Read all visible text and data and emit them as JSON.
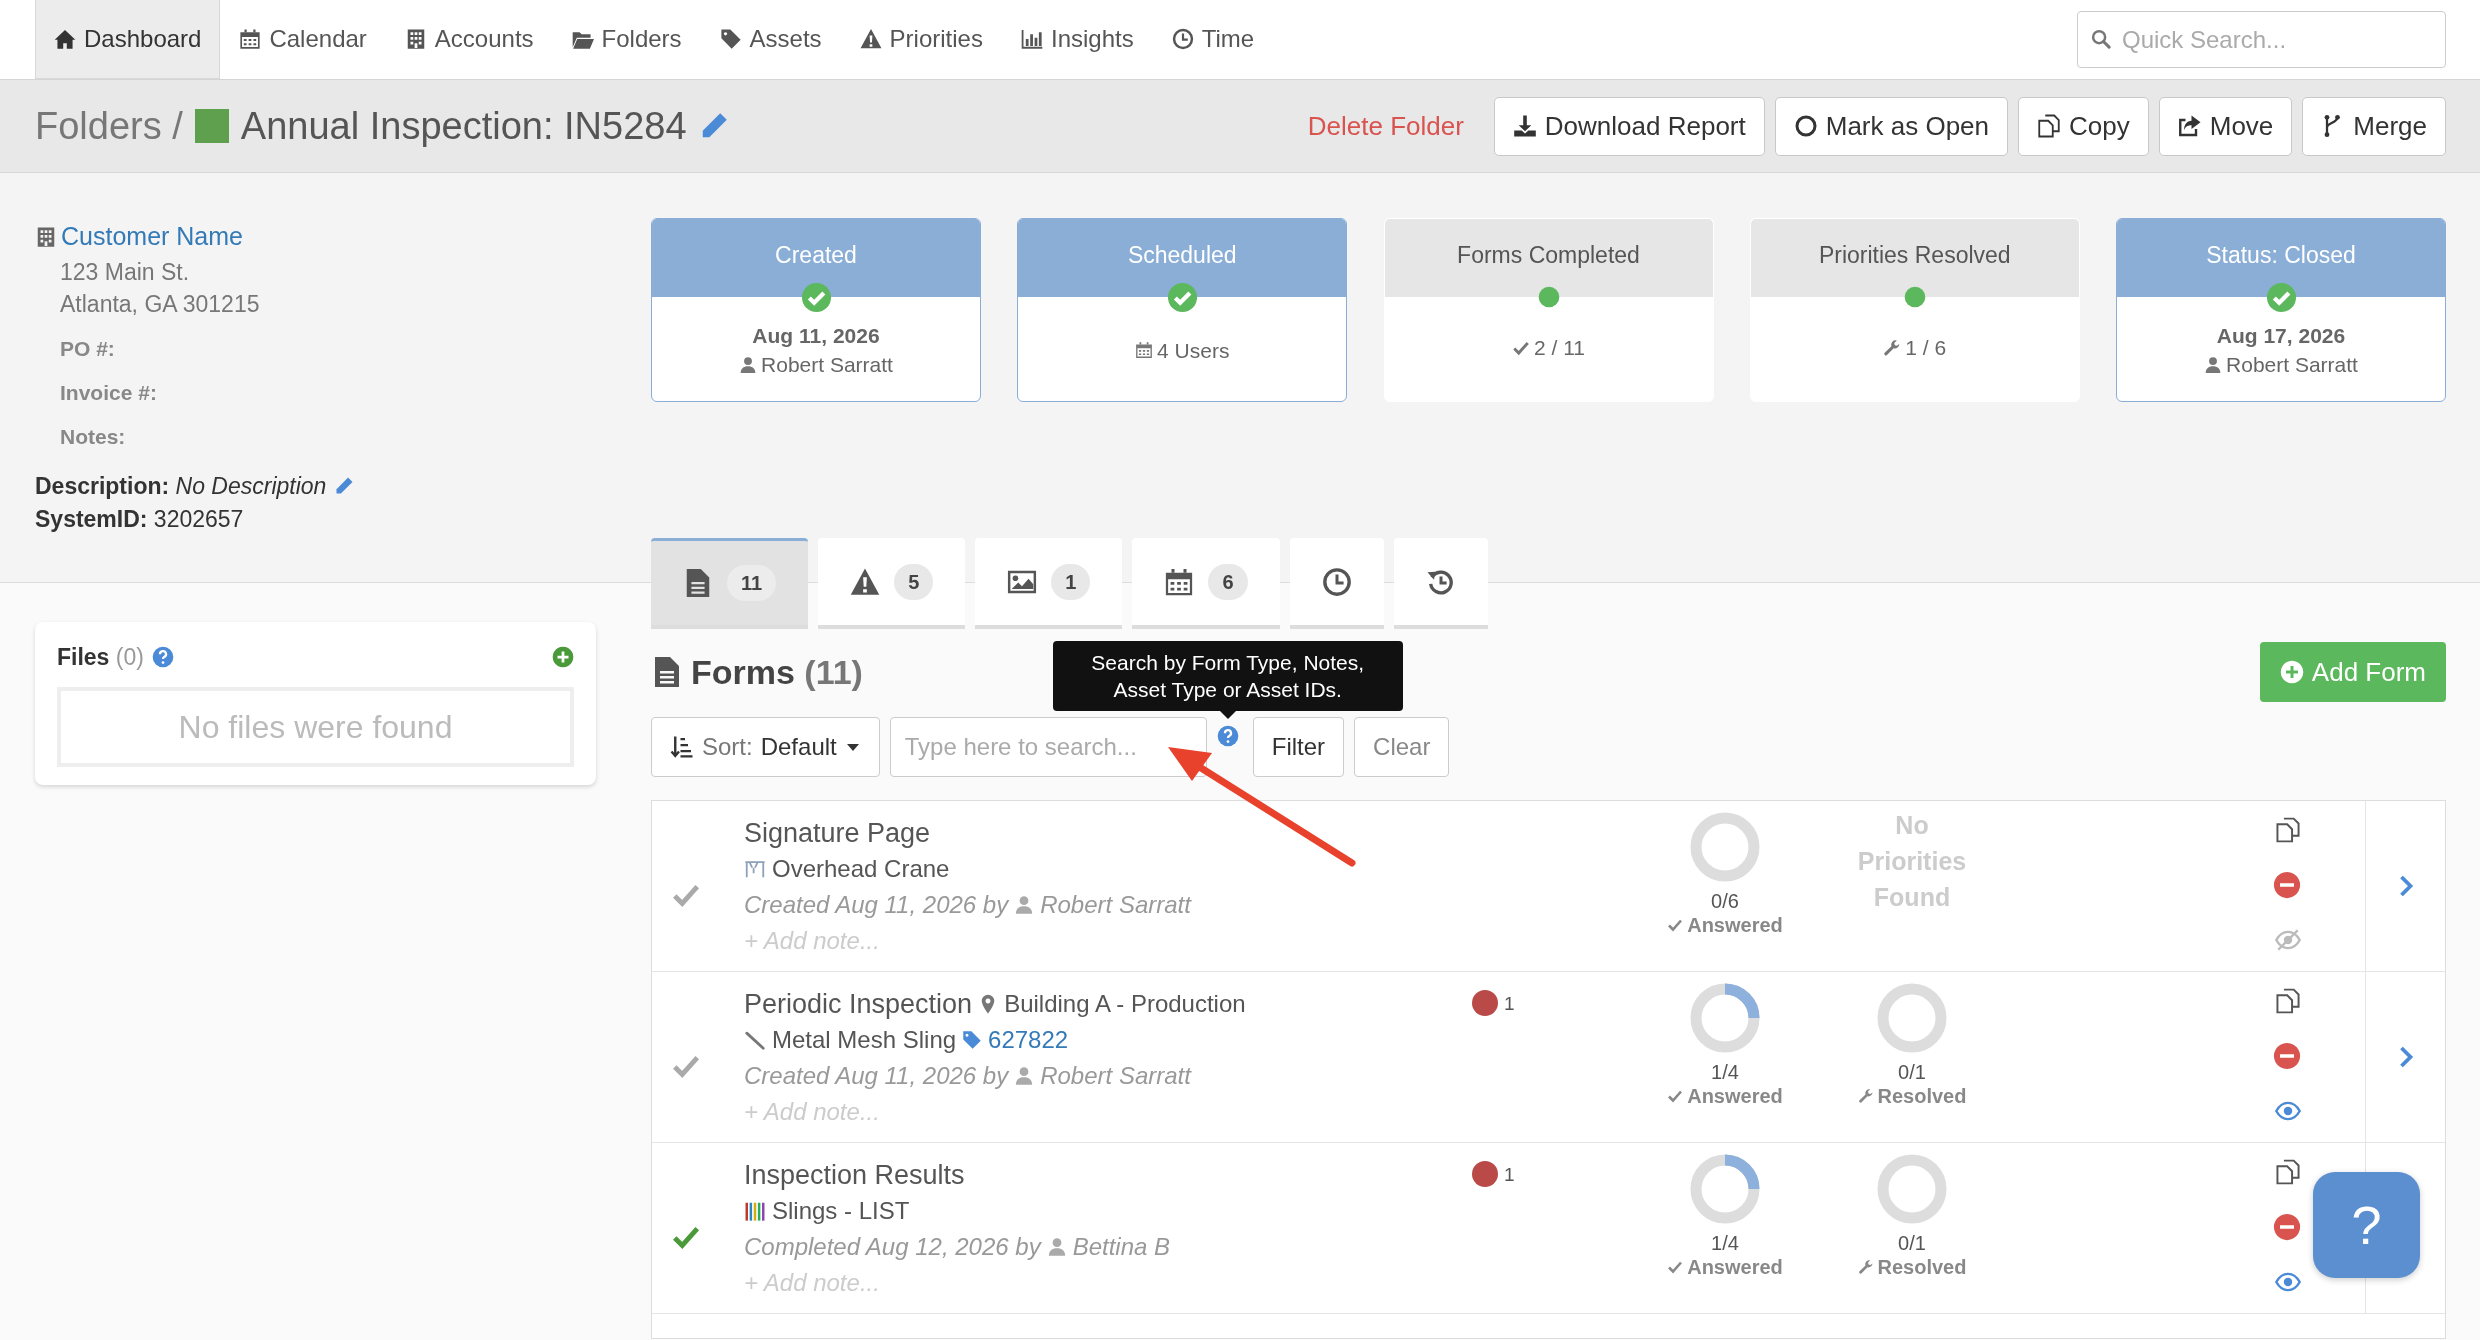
{
  "nav": {
    "items": [
      {
        "label": "Dashboard",
        "kind": "home",
        "selected": true
      },
      {
        "label": "Calendar",
        "kind": "calendar",
        "selected": false
      },
      {
        "label": "Accounts",
        "kind": "building",
        "selected": false
      },
      {
        "label": "Folders",
        "kind": "folder",
        "selected": false
      },
      {
        "label": "Assets",
        "kind": "tags",
        "selected": false
      },
      {
        "label": "Priorities",
        "kind": "warning",
        "selected": false
      },
      {
        "label": "Insights",
        "kind": "bars",
        "selected": false
      },
      {
        "label": "Time",
        "kind": "clock",
        "selected": false
      }
    ],
    "search": {
      "placeholder": "Quick Search..."
    }
  },
  "header": {
    "breadcrumb": "Folders /",
    "title": "Annual Inspection: IN5284",
    "actions": [
      {
        "label": "Delete Folder",
        "kind": "delete"
      },
      {
        "label": "Download Report",
        "kind": "download"
      },
      {
        "label": "Mark as Open",
        "kind": "open"
      },
      {
        "label": "Copy",
        "kind": "copy"
      },
      {
        "label": "Move",
        "kind": "move"
      },
      {
        "label": "Merge",
        "kind": "merge"
      }
    ]
  },
  "customer": {
    "name": "Customer Name",
    "address": [
      "123 Main St.",
      "Atlanta, GA 301215"
    ],
    "fields": [
      "PO #:",
      "Invoice #:",
      "Notes:"
    ],
    "description_label": "Description:",
    "description": "No Description",
    "system_label": "SystemID:",
    "system_id": "3202657"
  },
  "status_cards": [
    {
      "title": "Created",
      "done": true,
      "lines": [
        {
          "kind": "date",
          "text": "Aug 11, 2026"
        },
        {
          "kind": "user",
          "text": "Robert Sarratt"
        }
      ]
    },
    {
      "title": "Scheduled",
      "done": true,
      "lines": [
        {
          "kind": "users",
          "text": "4 Users"
        }
      ]
    },
    {
      "title": "Forms Completed",
      "done": false,
      "lines": [
        {
          "kind": "forms",
          "text": "2 / 11"
        }
      ]
    },
    {
      "title": "Priorities Resolved",
      "done": false,
      "lines": [
        {
          "kind": "priorities",
          "text": "1 / 6"
        }
      ]
    },
    {
      "title": "Status: Closed",
      "done": true,
      "lines": [
        {
          "kind": "date",
          "text": "Aug 17, 2026"
        },
        {
          "kind": "user",
          "text": "Robert Sarratt"
        }
      ]
    }
  ],
  "tabs": [
    {
      "kind": "forms",
      "count": "11",
      "selected": true
    },
    {
      "kind": "priorities",
      "count": "5",
      "selected": false
    },
    {
      "kind": "photos",
      "count": "1",
      "selected": false
    },
    {
      "kind": "schedule",
      "count": "6",
      "selected": false
    },
    {
      "kind": "time",
      "selected": false
    },
    {
      "kind": "history",
      "selected": false
    }
  ],
  "files": {
    "title": "Files",
    "count": "(0)",
    "empty": "No files were found"
  },
  "forms": {
    "title": "Forms",
    "count": "(11)",
    "add_button": "Add Form",
    "sort": {
      "label": "Sort:",
      "value": "Default"
    },
    "search": {
      "placeholder": "Type here to search..."
    },
    "tooltip": "Search by Form Type, Notes, Asset Type or Asset IDs.",
    "filter_button": "Filter",
    "clear_button": "Clear",
    "rows": [
      {
        "completed": false,
        "title": "Signature Page",
        "asset": {
          "kind": "crane",
          "name": "Overhead Crane"
        },
        "meta": "Created Aug 11, 2026 by",
        "user": "Robert Sarratt",
        "note": "+ Add note...",
        "answered": {
          "value": "0/6",
          "label": "Answered",
          "level": 0
        },
        "no_priorities": "No Priorities Found",
        "visible": false,
        "has_link": true
      },
      {
        "completed": false,
        "title": "Periodic Inspection",
        "location": "Building A - Production",
        "asset": {
          "kind": "sling",
          "name": "Metal Mesh Sling"
        },
        "tag": "627822",
        "meta": "Created Aug 11, 2026 by",
        "user": "Robert Sarratt",
        "note": "+ Add note...",
        "priority_count": "1",
        "answered": {
          "value": "1/4",
          "label": "Answered",
          "level": 0.25
        },
        "resolved": {
          "value": "0/1",
          "label": "Resolved",
          "level": 0
        },
        "visible": true,
        "has_link": true
      },
      {
        "completed": true,
        "title": "Inspection Results",
        "asset": {
          "kind": "slings",
          "name": "Slings - LIST"
        },
        "meta": "Completed Aug 12, 2026 by",
        "user": "Bettina B",
        "note": "+ Add note...",
        "priority_count": "1",
        "answered": {
          "value": "1/4",
          "label": "Answered",
          "level": 0.25
        },
        "resolved": {
          "value": "0/1",
          "label": "Resolved",
          "level": 0
        },
        "visible": true,
        "has_link": false
      }
    ]
  },
  "help_button": "?"
}
